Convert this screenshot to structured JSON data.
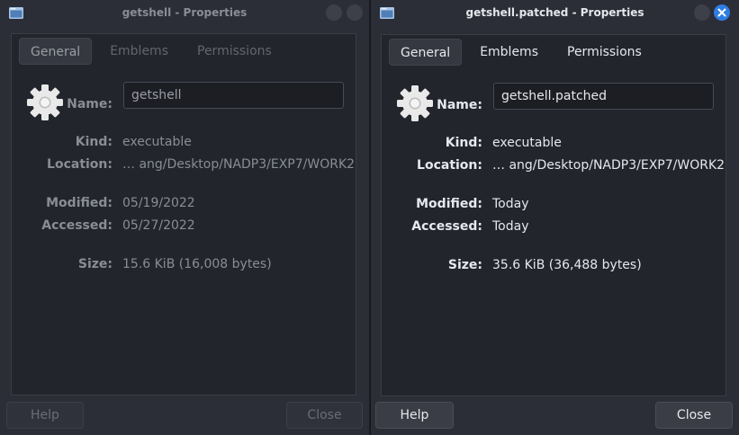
{
  "left_window": {
    "title": "getshell - Properties",
    "tabs": [
      "General",
      "Emblems",
      "Permissions"
    ],
    "name_label": "Name:",
    "name_value": "getshell",
    "kind_label": "Kind:",
    "kind_value": "executable",
    "location_label": "Location:",
    "location_value": "… ang/Desktop/NADP3/EXP7/WORK2",
    "modified_label": "Modified:",
    "modified_value": "05/19/2022",
    "accessed_label": "Accessed:",
    "accessed_value": "05/27/2022",
    "size_label": "Size:",
    "size_value": "15.6 KiB (16,008 bytes)",
    "help_label": "Help",
    "close_label": "Close"
  },
  "right_window": {
    "title": "getshell.patched - Properties",
    "tabs": [
      "General",
      "Emblems",
      "Permissions"
    ],
    "name_label": "Name:",
    "name_value": "getshell.patched",
    "kind_label": "Kind:",
    "kind_value": "executable",
    "location_label": "Location:",
    "location_value": "… ang/Desktop/NADP3/EXP7/WORK2",
    "modified_label": "Modified:",
    "modified_value": "Today",
    "accessed_label": "Accessed:",
    "accessed_value": "Today",
    "size_label": "Size:",
    "size_value": "35.6 KiB (36,488 bytes)",
    "help_label": "Help",
    "close_label": "Close"
  },
  "icons": {
    "app": "folder-window-icon",
    "file": "gear-icon",
    "close": "close-icon"
  },
  "colors": {
    "accent_close": "#2f7de3",
    "window_bg": "#2b2e36",
    "panel_bg": "#22252c"
  }
}
